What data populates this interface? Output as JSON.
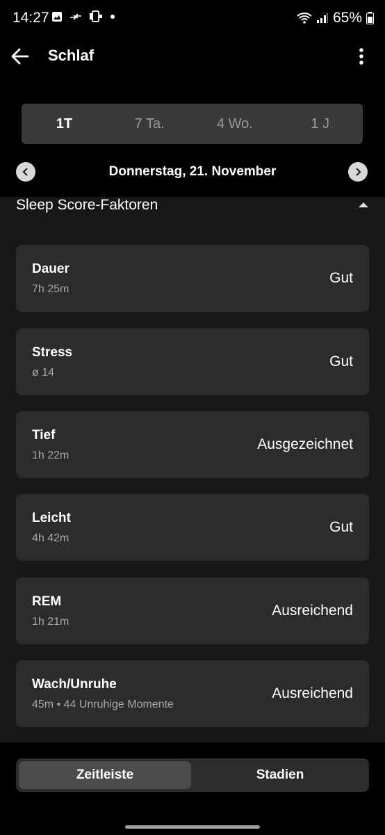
{
  "status_bar": {
    "time": "14:27",
    "battery": "65%"
  },
  "appbar": {
    "title": "Schlaf"
  },
  "segments": [
    "1T",
    "7 Ta.",
    "4 Wo.",
    "1 J"
  ],
  "date": "Donnerstag, 21. November",
  "section": {
    "title": "Sleep Score-Faktoren"
  },
  "factors": [
    {
      "title": "Dauer",
      "sub": "7h 25m",
      "rating": "Gut"
    },
    {
      "title": "Stress",
      "sub": "ø 14",
      "rating": "Gut"
    },
    {
      "title": "Tief",
      "sub": "1h 22m",
      "rating": "Ausgezeichnet"
    },
    {
      "title": "Leicht",
      "sub": "4h 42m",
      "rating": "Gut"
    },
    {
      "title": "REM",
      "sub": "1h 21m",
      "rating": "Ausreichend"
    },
    {
      "title": "Wach/Unruhe",
      "sub": "45m • 44 Unruhige Momente",
      "rating": "Ausreichend"
    }
  ],
  "bottom_tabs": [
    "Zeitleiste",
    "Stadien"
  ]
}
